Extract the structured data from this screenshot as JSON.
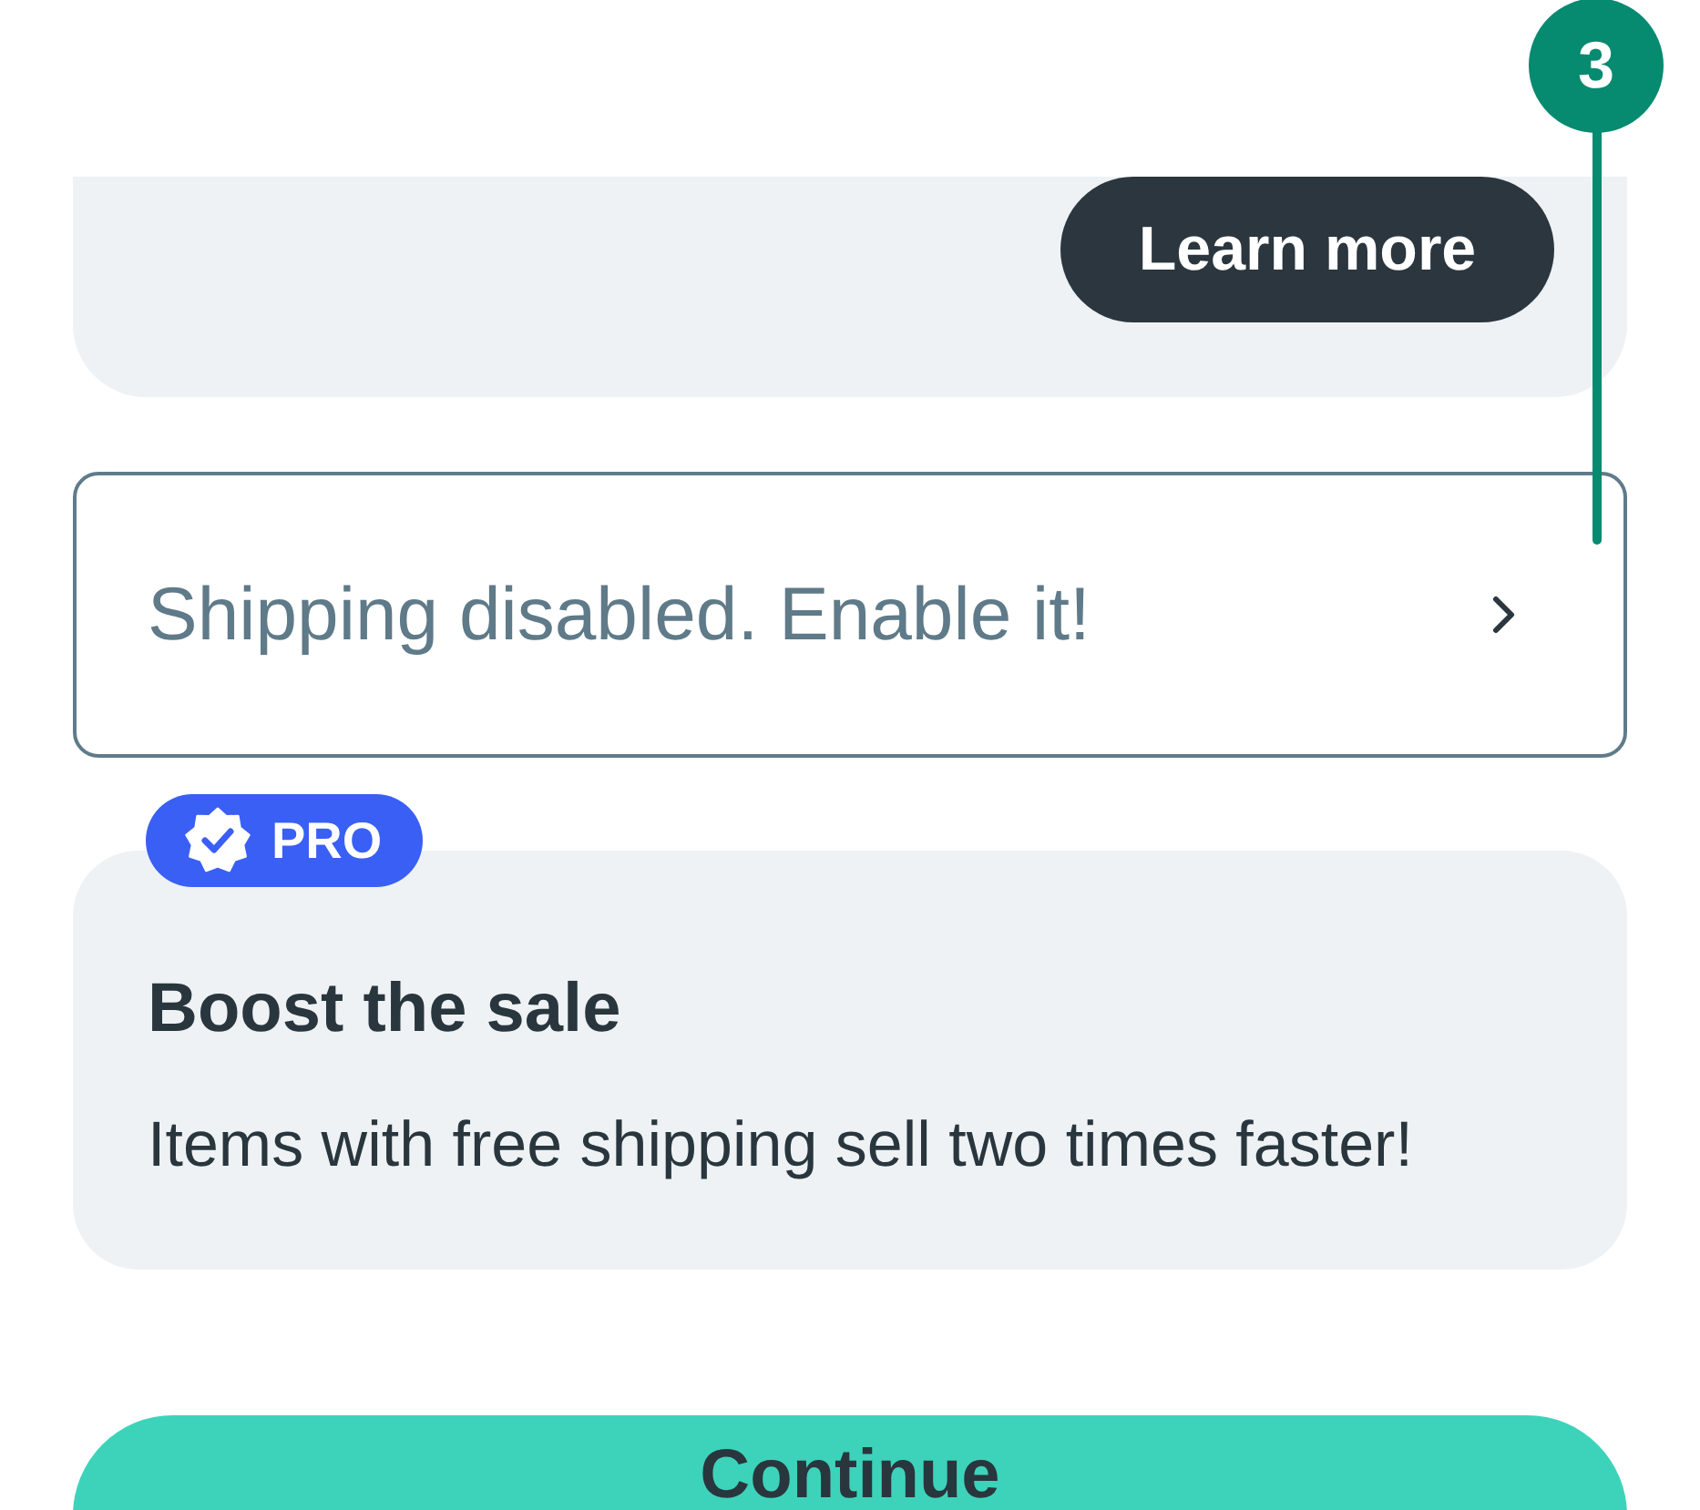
{
  "annotation": {
    "label": "3"
  },
  "promo_card": {
    "button": "Learn more"
  },
  "shipping_row": {
    "text": "Shipping disabled. Enable it!"
  },
  "boost_card": {
    "badge": "PRO",
    "title": "Boost the sale",
    "text": "Items with free shipping sell two times faster!"
  },
  "continue_button": {
    "label": "Continue"
  }
}
